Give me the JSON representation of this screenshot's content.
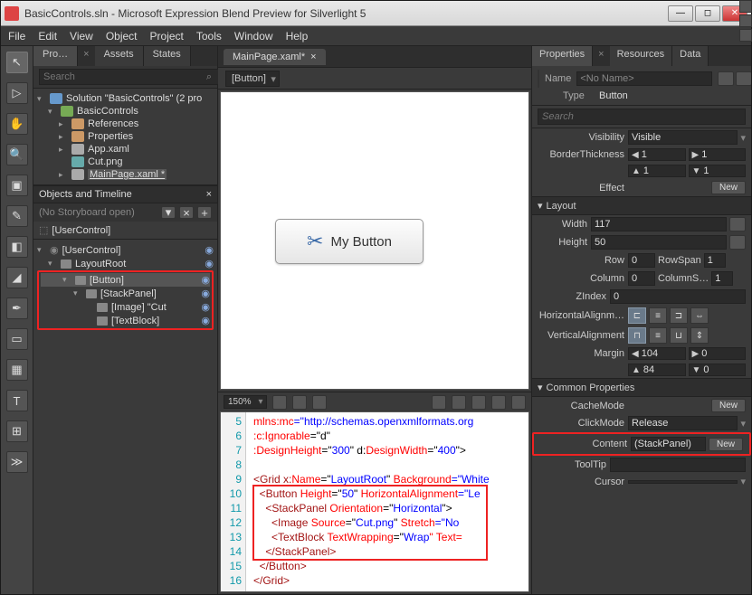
{
  "title": "BasicControls.sln - Microsoft Expression Blend Preview for Silverlight 5",
  "menu": [
    "File",
    "Edit",
    "View",
    "Object",
    "Project",
    "Tools",
    "Window",
    "Help"
  ],
  "leftTabs": {
    "projects": "Pro…",
    "assets": "Assets",
    "states": "States"
  },
  "searchPlaceholder": "Search",
  "solution": {
    "root": "Solution \"BasicControls\" (2 pro",
    "project": "BasicControls",
    "refs": "References",
    "props": "Properties",
    "app": "App.xaml",
    "cut": "Cut.png",
    "main": "MainPage.xaml *"
  },
  "timeline": {
    "header": "Objects and Timeline",
    "nostory": "(No Storyboard open)",
    "usercontrol": "[UserControl]"
  },
  "objtree": {
    "uc": "[UserControl]",
    "layout": "LayoutRoot",
    "button": "[Button]",
    "stack": "[StackPanel]",
    "image": "[Image] \"Cut",
    "text": "[TextBlock]"
  },
  "docTab": "MainPage.xaml*",
  "objSelector": "[Button]",
  "buttonPreview": {
    "icon": "✂",
    "label": "My Button"
  },
  "zoom": "150%",
  "code": {
    "lines": [
      5,
      6,
      7,
      8,
      9,
      10,
      11,
      12,
      13,
      14,
      15,
      16
    ],
    "l5a": "mlns:",
    "l5b": "mc",
    "l5c": "=\"http://schemas.openxmlformats.org",
    "l6a": ":c:",
    "l6b": "Ignorable",
    "l6c": "=\"d\"",
    "l7a": ":",
    "l7b": "DesignHeight",
    "l7c": "=\"",
    "l7d": "300",
    "l7e": "\" d:",
    "l7f": "DesignWidth",
    "l7g": "=\"",
    "l7h": "400",
    "l7i": "\">",
    "l9a": "<Grid x:",
    "l9b": "Name",
    "l9c": "=\"",
    "l9d": "LayoutRoot",
    "l9e": "\" ",
    "l9f": "Background",
    "l9g": "=\"White",
    "l10a": "<Button ",
    "l10b": "Height",
    "l10c": "=\"",
    "l10d": "50",
    "l10e": "\" ",
    "l10f": "HorizontalAlignment",
    "l10g": "=\"Le",
    "l11a": "<StackPanel ",
    "l11b": "Orientation",
    "l11c": "=\"",
    "l11d": "Horizontal",
    "l11e": "\">",
    "l12a": "<Image ",
    "l12b": "Source",
    "l12c": "=\"",
    "l12d": "Cut.png",
    "l12e": "\" ",
    "l12f": "Stretch",
    "l12g": "=\"No",
    "l13a": "<TextBlock ",
    "l13b": "TextWrapping",
    "l13c": "=\"",
    "l13d": "Wrap",
    "l13e": "\" Text=",
    "l14": "</StackPanel>",
    "l15": "</Button>",
    "l16": "</Grid>"
  },
  "rightTabs": {
    "props": "Properties",
    "res": "Resources",
    "data": "Data"
  },
  "nameRow": {
    "nameLbl": "Name",
    "nameVal": "<No Name>",
    "typeLbl": "Type",
    "typeVal": "Button"
  },
  "propSearchPlaceholder": "Search",
  "visibility": {
    "lbl": "Visibility",
    "val": "Visible"
  },
  "borderThickness": {
    "lbl": "BorderThickness",
    "l": "1",
    "t": "1",
    "r": "1",
    "b": "1"
  },
  "effect": {
    "lbl": "Effect",
    "btn": "New"
  },
  "layoutCat": "Layout",
  "width": {
    "lbl": "Width",
    "val": "117"
  },
  "height": {
    "lbl": "Height",
    "val": "50"
  },
  "row": {
    "lbl": "Row",
    "val": "0",
    "spanLbl": "RowSpan",
    "spanVal": "1"
  },
  "col": {
    "lbl": "Column",
    "val": "0",
    "spanLbl": "ColumnS…",
    "spanVal": "1"
  },
  "zindex": {
    "lbl": "ZIndex",
    "val": "0"
  },
  "halign": {
    "lbl": "HorizontalAlignm…"
  },
  "valign": {
    "lbl": "VerticalAlignment"
  },
  "margin": {
    "lbl": "Margin",
    "l": "104",
    "r": "0",
    "t": "84",
    "b": "0"
  },
  "commonCat": "Common Properties",
  "cacheMode": {
    "lbl": "CacheMode",
    "btn": "New"
  },
  "clickMode": {
    "lbl": "ClickMode",
    "val": "Release"
  },
  "content": {
    "lbl": "Content",
    "val": "(StackPanel)",
    "btn": "New"
  },
  "tooltip": {
    "lbl": "ToolTip"
  },
  "cursor": {
    "lbl": "Cursor"
  }
}
